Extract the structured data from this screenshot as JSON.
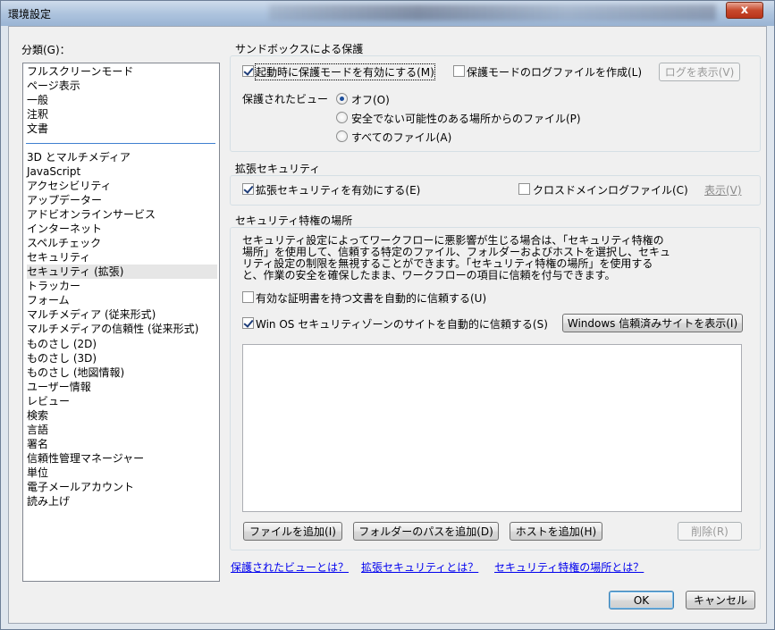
{
  "window": {
    "title": "環境設定",
    "close_glyph": "x"
  },
  "categories": {
    "label": "分類(G)：",
    "group1": [
      "フルスクリーンモード",
      "ページ表示",
      "一般",
      "注釈",
      "文書"
    ],
    "group2": [
      "3D とマルチメディア",
      "JavaScript",
      "アクセシビリティ",
      "アップデーター",
      "アドビオンラインサービス",
      "インターネット",
      "スペルチェック",
      "セキュリティ",
      "セキュリティ (拡張)",
      "トラッカー",
      "フォーム",
      "マルチメディア (従来形式)",
      "マルチメディアの信頼性 (従来形式)",
      "ものさし (2D)",
      "ものさし (3D)",
      "ものさし (地図情報)",
      "ユーザー情報",
      "レビュー",
      "検索",
      "言語",
      "署名",
      "信頼性管理マネージャー",
      "単位",
      "電子メールアカウント",
      "読み上げ"
    ],
    "selected": "セキュリティ (拡張)"
  },
  "sandbox": {
    "title": "サンドボックスによる保護",
    "enable_protected_mode": "起動時に保護モードを有効にする(M)",
    "enable_protected_mode_checked": true,
    "create_log": "保護モードのログファイルを作成(L)",
    "create_log_checked": false,
    "view_log_button": "ログを表示(V)",
    "protected_view_label": "保護されたビュー",
    "radio_options": [
      "オフ(O)",
      "安全でない可能性のある場所からのファイル(P)",
      "すべてのファイル(A)"
    ],
    "radio_selected": "オフ(O)"
  },
  "enhanced": {
    "title": "拡張セキュリティ",
    "enable": "拡張セキュリティを有効にする(E)",
    "enable_checked": true,
    "cross_domain_log": "クロスドメインログファイル(C)",
    "cross_domain_log_checked": false,
    "show_button": "表示(V)"
  },
  "privileged": {
    "title": "セキュリティ特権の場所",
    "description": [
      "セキュリティ設定によってワークフローに悪影響が生じる場合は、「セキュリティ特権の",
      "場所」を使用して、信頼する特定のファイル、フォルダーおよびホストを選択し、セキュ",
      "リティ設定の制限を無視することができます。「セキュリティ特権の場所」を使用する",
      "と、作業の安全を確保したまま、ワークフローの項目に信頼を付与できます。"
    ],
    "trust_certified": "有効な証明書を持つ文書を自動的に信頼する(U)",
    "trust_certified_checked": false,
    "trust_win_zone": "Win OS セキュリティゾーンのサイトを自動的に信頼する(S)",
    "trust_win_zone_checked": true,
    "show_trusted_sites_button": "Windows 信頼済みサイトを表示(I)",
    "add_file_button": "ファイルを追加(I)",
    "add_folder_button": "フォルダーのパスを追加(D)",
    "add_host_button": "ホストを追加(H)",
    "remove_button": "削除(R)"
  },
  "links": {
    "protected_view": "保護されたビューとは？",
    "enhanced": "拡張セキュリティとは？",
    "privileged": "セキュリティ特権の場所とは？"
  },
  "footer": {
    "ok_button": "OK",
    "cancel_button": "キャンセル"
  }
}
